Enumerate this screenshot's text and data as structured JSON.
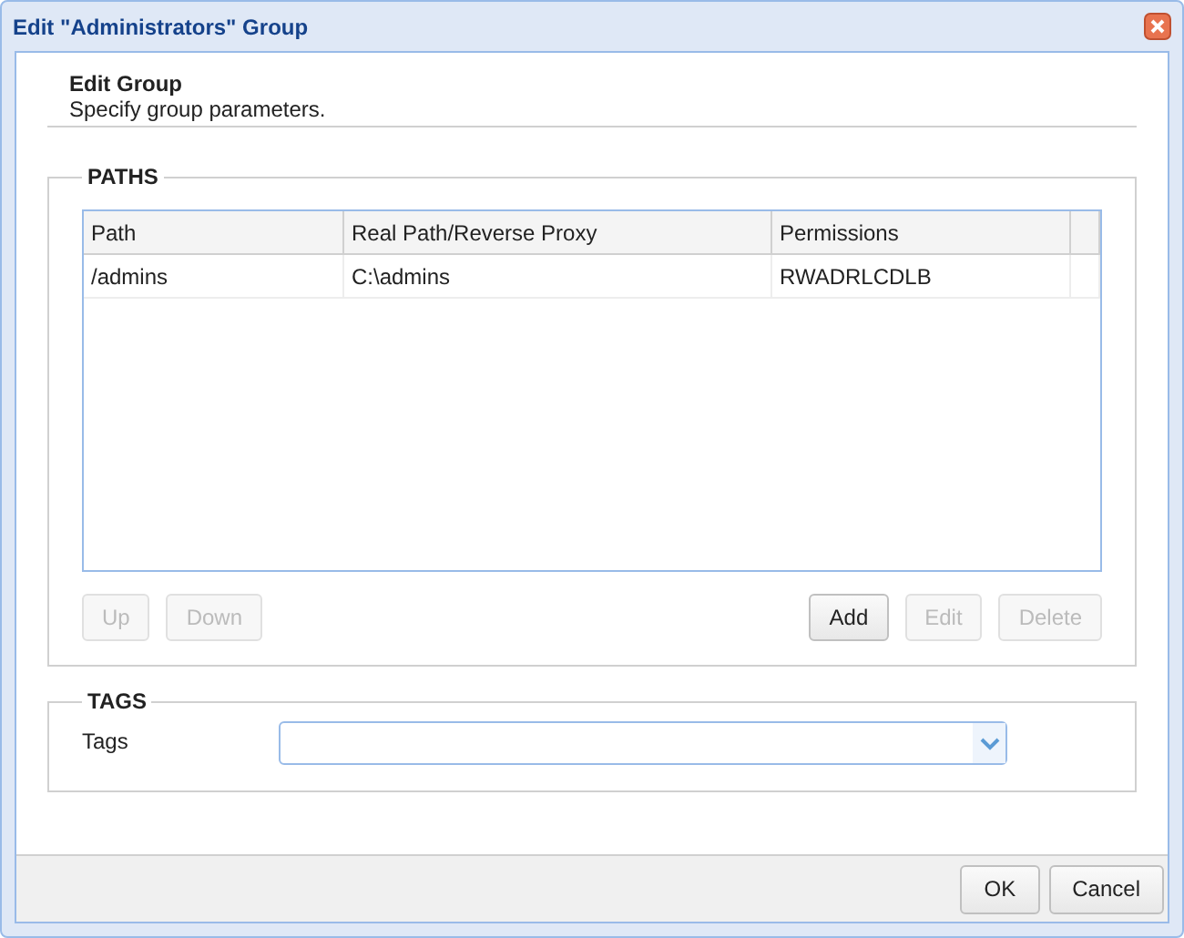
{
  "window": {
    "title": "Edit \"Administrators\" Group"
  },
  "header": {
    "title": "Edit Group",
    "subtitle": "Specify group parameters."
  },
  "paths": {
    "legend": "PATHS",
    "columns": [
      "Path",
      "Real Path/Reverse Proxy",
      "Permissions"
    ],
    "rows": [
      [
        "/admins",
        "C:\\admins",
        "RWADRLCDLB"
      ]
    ],
    "left_buttons": [
      {
        "label": "Up",
        "disabled": true
      },
      {
        "label": "Down",
        "disabled": true
      }
    ],
    "right_buttons": [
      {
        "label": "Add",
        "disabled": false
      },
      {
        "label": "Edit",
        "disabled": true
      },
      {
        "label": "Delete",
        "disabled": true
      }
    ]
  },
  "tags": {
    "legend": "TAGS",
    "label": "Tags"
  },
  "footer_buttons": [
    {
      "label": "OK",
      "disabled": false
    },
    {
      "label": "Cancel",
      "disabled": false
    }
  ]
}
